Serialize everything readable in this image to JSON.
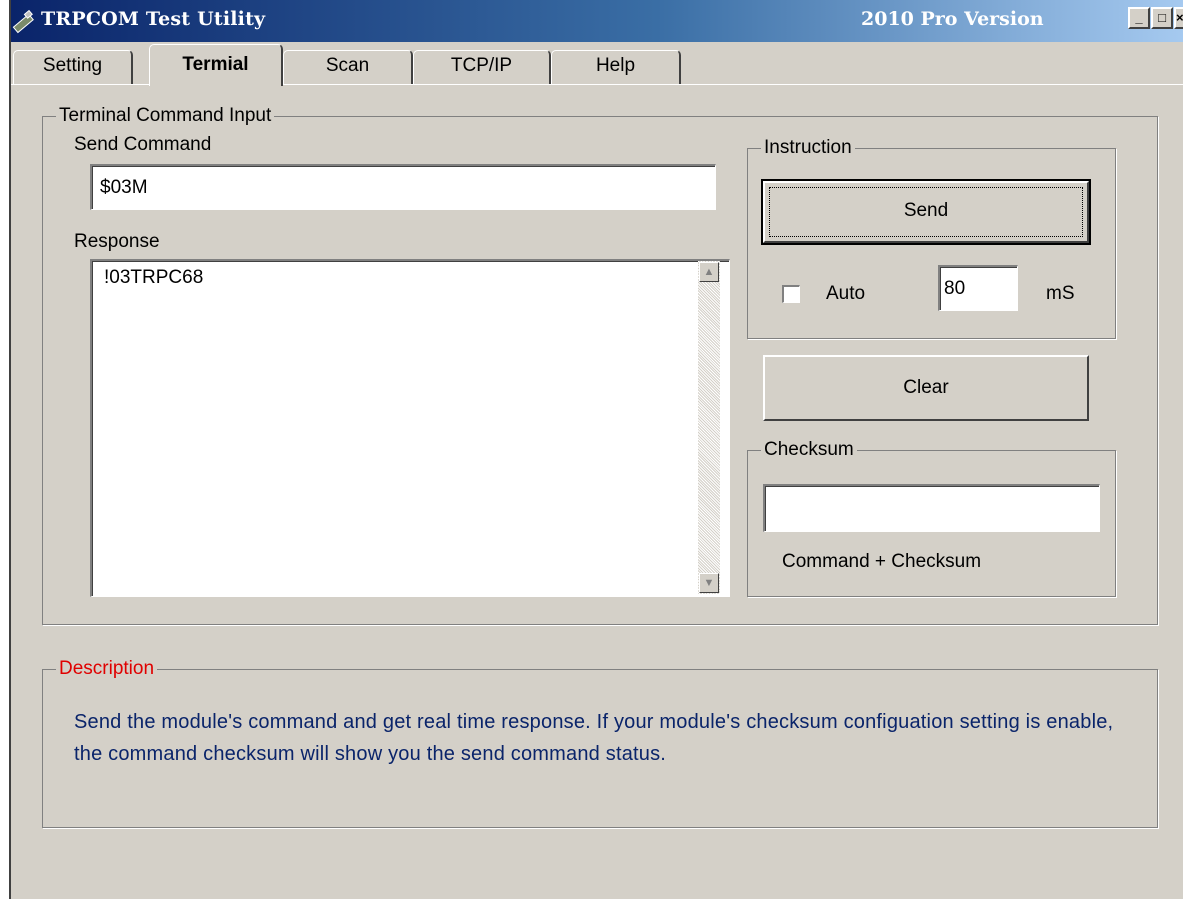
{
  "window": {
    "title": "TRPCOM Test Utility",
    "version": "2010 Pro Version",
    "controls": {
      "minimize": "_",
      "maximize": "□",
      "close": "×"
    }
  },
  "tabs": [
    {
      "label": "Setting",
      "active": false
    },
    {
      "label": "Termial",
      "active": true
    },
    {
      "label": "Scan",
      "active": false
    },
    {
      "label": "TCP/IP",
      "active": false
    },
    {
      "label": "Help",
      "active": false
    }
  ],
  "terminal": {
    "group_label": "Terminal Command Input",
    "send_label": "Send Command",
    "send_value": "$03M",
    "response_label": "Response",
    "response_value": "!03TRPC68"
  },
  "instruction": {
    "group_label": "Instruction",
    "send_button": "Send",
    "auto_label": "Auto",
    "auto_checked": false,
    "interval_value": "80",
    "interval_unit": "mS"
  },
  "clear_button": "Clear",
  "checksum": {
    "group_label": "Checksum",
    "value": "",
    "caption": "Command + Checksum"
  },
  "description": {
    "label": "Description",
    "label_color": "#e00000",
    "text_color": "#0a246a",
    "text": "Send the module's command and get  real time response. If your module's checksum configuation setting is enable, the command checksum will show you the send command status."
  }
}
